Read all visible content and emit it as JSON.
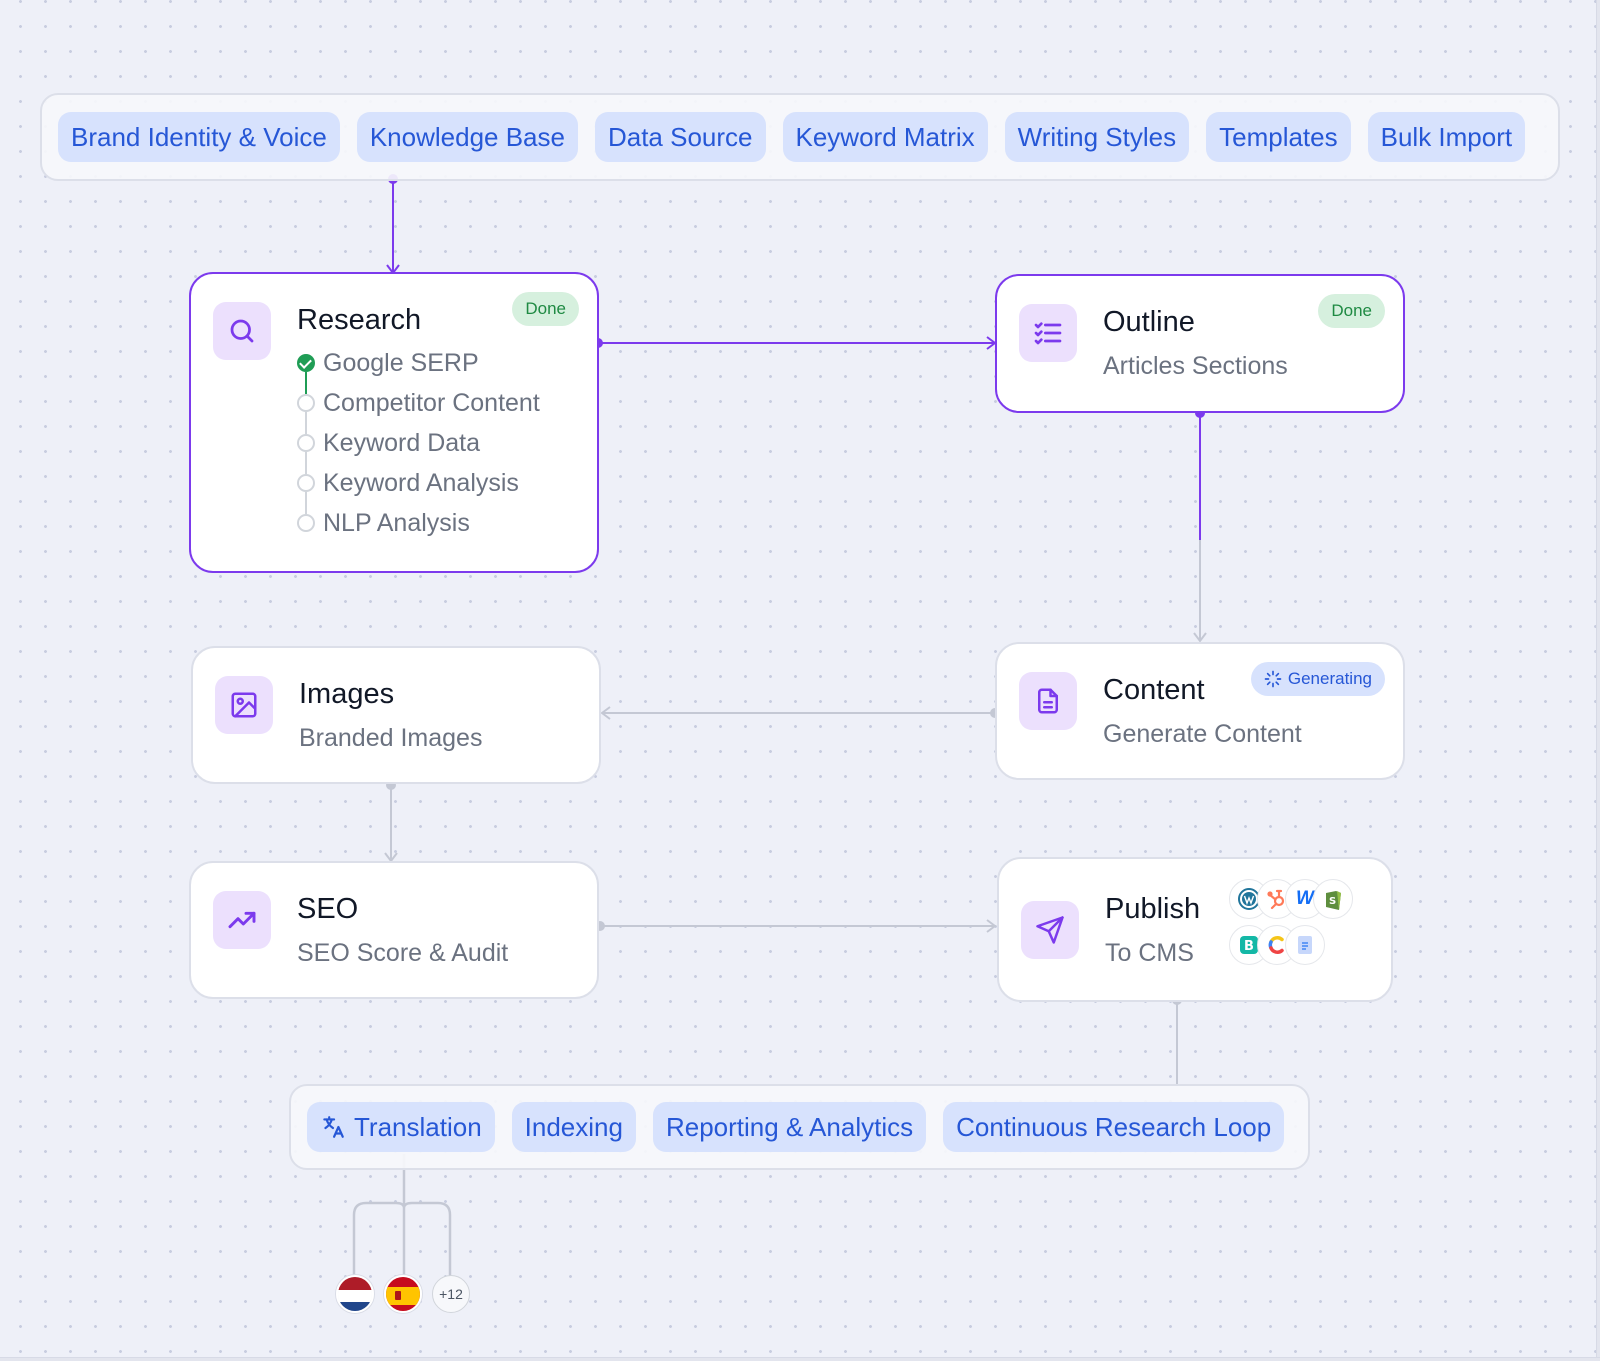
{
  "top_tools": [
    "Brand Identity & Voice",
    "Knowledge Base",
    "Data Source",
    "Keyword Matrix",
    "Writing Styles",
    "Templates",
    "Bulk Import"
  ],
  "research": {
    "title": "Research",
    "badge": "Done",
    "steps": [
      "Google SERP",
      "Competitor Content",
      "Keyword Data",
      "Keyword Analysis",
      "NLP Analysis"
    ],
    "steps_completed": 1
  },
  "outline": {
    "title": "Outline",
    "subtitle": "Articles Sections",
    "badge": "Done"
  },
  "content": {
    "title": "Content",
    "subtitle": "Generate Content",
    "badge": "Generating"
  },
  "images": {
    "title": "Images",
    "subtitle": "Branded Images"
  },
  "seo": {
    "title": "SEO",
    "subtitle": "SEO Score & Audit"
  },
  "publish": {
    "title": "Publish",
    "subtitle": "To CMS",
    "cms_icons": [
      "wordpress-icon",
      "hubspot-icon",
      "webflow-icon",
      "shopify-icon",
      "blogger-icon",
      "contentful-icon",
      "google-docs-icon"
    ]
  },
  "bottom_tools": [
    "Translation",
    "Indexing",
    "Reporting & Analytics",
    "Continuous Research Loop"
  ],
  "languages": {
    "flags": [
      "netherlands-flag",
      "spain-flag"
    ],
    "more": "+12"
  },
  "colors": {
    "accent": "#7c3aed",
    "pill_text": "#2657d6",
    "pill_bg": "#d7e2fd",
    "done": "#1f9d55",
    "wire_inactive": "#c4c8d4"
  }
}
